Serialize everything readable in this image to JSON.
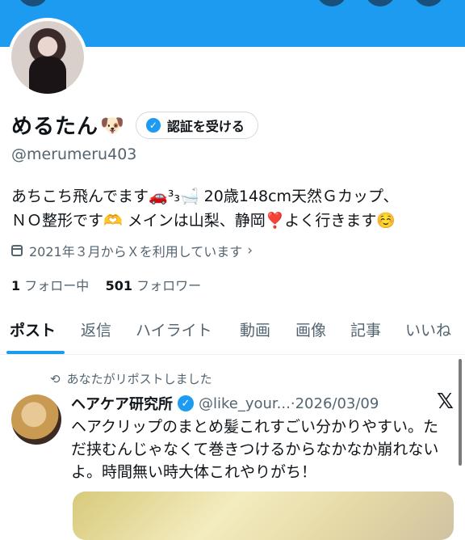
{
  "profile": {
    "name": "めるたん",
    "name_emoji": "🐶",
    "verify_button": "認証を受ける",
    "handle": "@merumeru403",
    "bio_line1": "あちこち飛んでます🚗³₃🛁 20歳148cm天然Ｇカップ、",
    "bio_line2": "ＮＯ整形です🫶 メインは山梨、静岡❣️よく行きます☺️",
    "joined": "2021年３月からＸを利用しています",
    "following_count": "1",
    "following_label": "フォロー中",
    "followers_count": "501",
    "followers_label": "フォロワー"
  },
  "tabs": [
    "ポスト",
    "返信",
    "ハイライト",
    "動画",
    "画像",
    "記事",
    "いいね"
  ],
  "post": {
    "repost_note": "あなたがリポストしました",
    "author_name": "ヘアケア研究所",
    "author_handle": "@like_your...",
    "separator": "·",
    "date": "2026/03/09",
    "text": "ヘアクリップのまとめ髪これすごい分かりやすい。ただ挟むんじゃなくて巻きつけるからなかなか崩れないよ。時間無い時大体これやりがち！"
  },
  "colors": {
    "accent": "#1d9bf0",
    "text": "#0f1419",
    "muted": "#536471"
  },
  "icons": [
    "calendar-icon",
    "chevron-right-icon",
    "repost-icon",
    "verified-badge-icon",
    "x-logo-icon"
  ]
}
